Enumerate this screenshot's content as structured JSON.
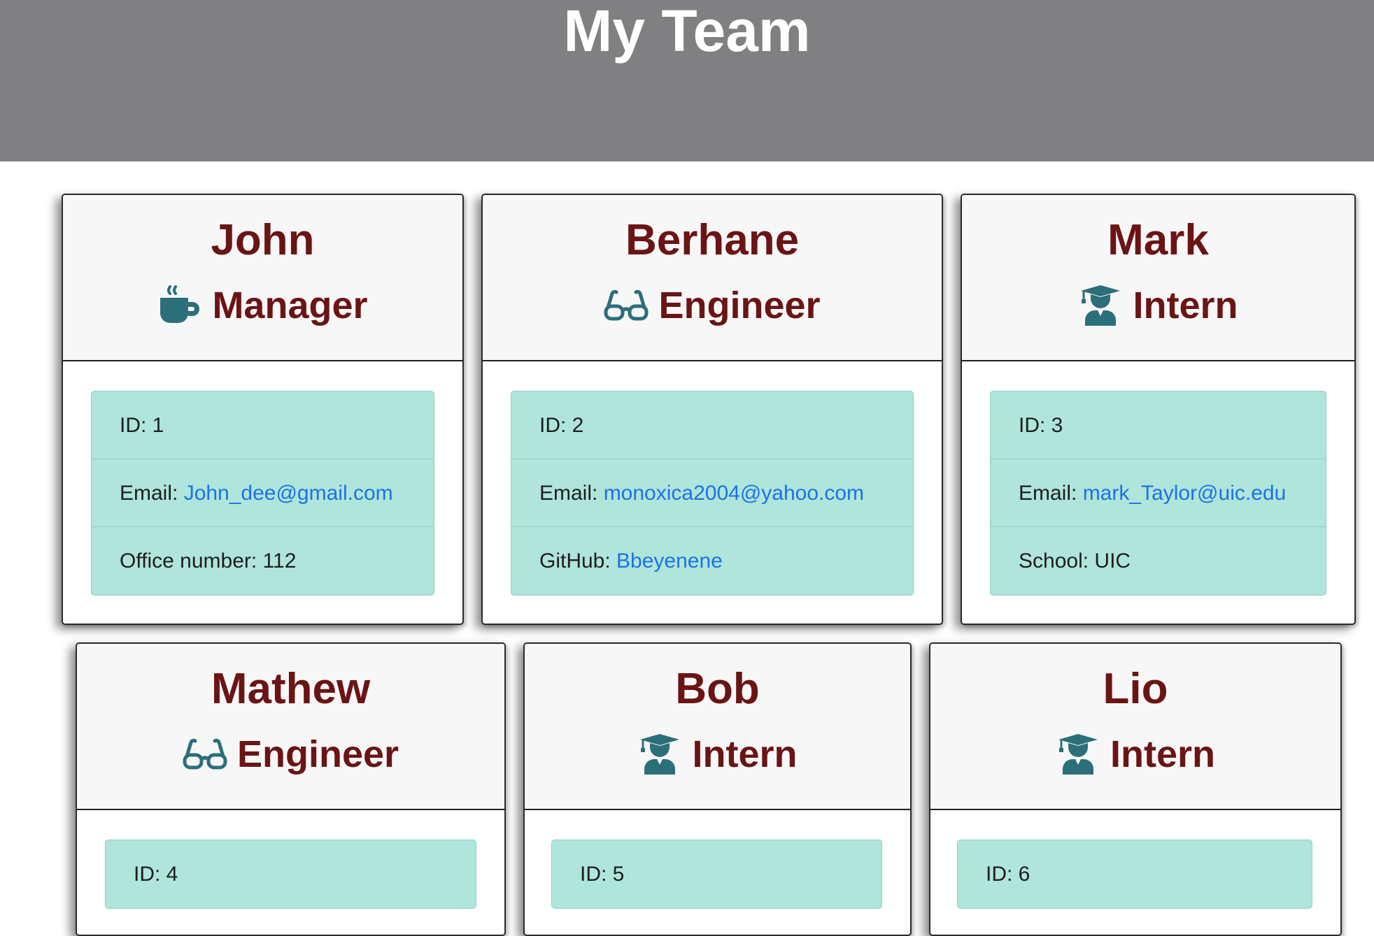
{
  "header": {
    "title": "My Team"
  },
  "team": [
    {
      "name": "John",
      "role": "Manager",
      "role_icon": "coffee-mug-icon",
      "rows": [
        {
          "label": "ID: ",
          "value": "1",
          "is_link": false
        },
        {
          "label": "Email: ",
          "value": "John_dee@gmail.com",
          "is_link": true
        },
        {
          "label": "Office number: ",
          "value": "112",
          "is_link": false
        }
      ]
    },
    {
      "name": "Berhane",
      "role": "Engineer",
      "role_icon": "glasses-icon",
      "rows": [
        {
          "label": "ID: ",
          "value": "2",
          "is_link": false
        },
        {
          "label": "Email: ",
          "value": "monoxica2004@yahoo.com",
          "is_link": true
        },
        {
          "label": "GitHub: ",
          "value": "Bbeyenene",
          "is_link": true
        }
      ]
    },
    {
      "name": "Mark",
      "role": "Intern",
      "role_icon": "graduate-icon",
      "rows": [
        {
          "label": "ID: ",
          "value": "3",
          "is_link": false
        },
        {
          "label": "Email: ",
          "value": "mark_Taylor@uic.edu",
          "is_link": true
        },
        {
          "label": "School: ",
          "value": "UIC",
          "is_link": false
        }
      ]
    },
    {
      "name": "Mathew",
      "role": "Engineer",
      "role_icon": "glasses-icon",
      "rows": [
        {
          "label": "ID: ",
          "value": "4",
          "is_link": false
        }
      ]
    },
    {
      "name": "Bob",
      "role": "Intern",
      "role_icon": "graduate-icon",
      "rows": [
        {
          "label": "ID: ",
          "value": "5",
          "is_link": false
        }
      ]
    },
    {
      "name": "Lio",
      "role": "Intern",
      "role_icon": "graduate-icon",
      "rows": [
        {
          "label": "ID: ",
          "value": "6",
          "is_link": false
        }
      ]
    }
  ],
  "colors": {
    "header_bg": "#808082",
    "name_text": "#6b1414",
    "icon": "#2b6f7a",
    "list_bg": "#afe5db",
    "link": "#1a73e8"
  }
}
